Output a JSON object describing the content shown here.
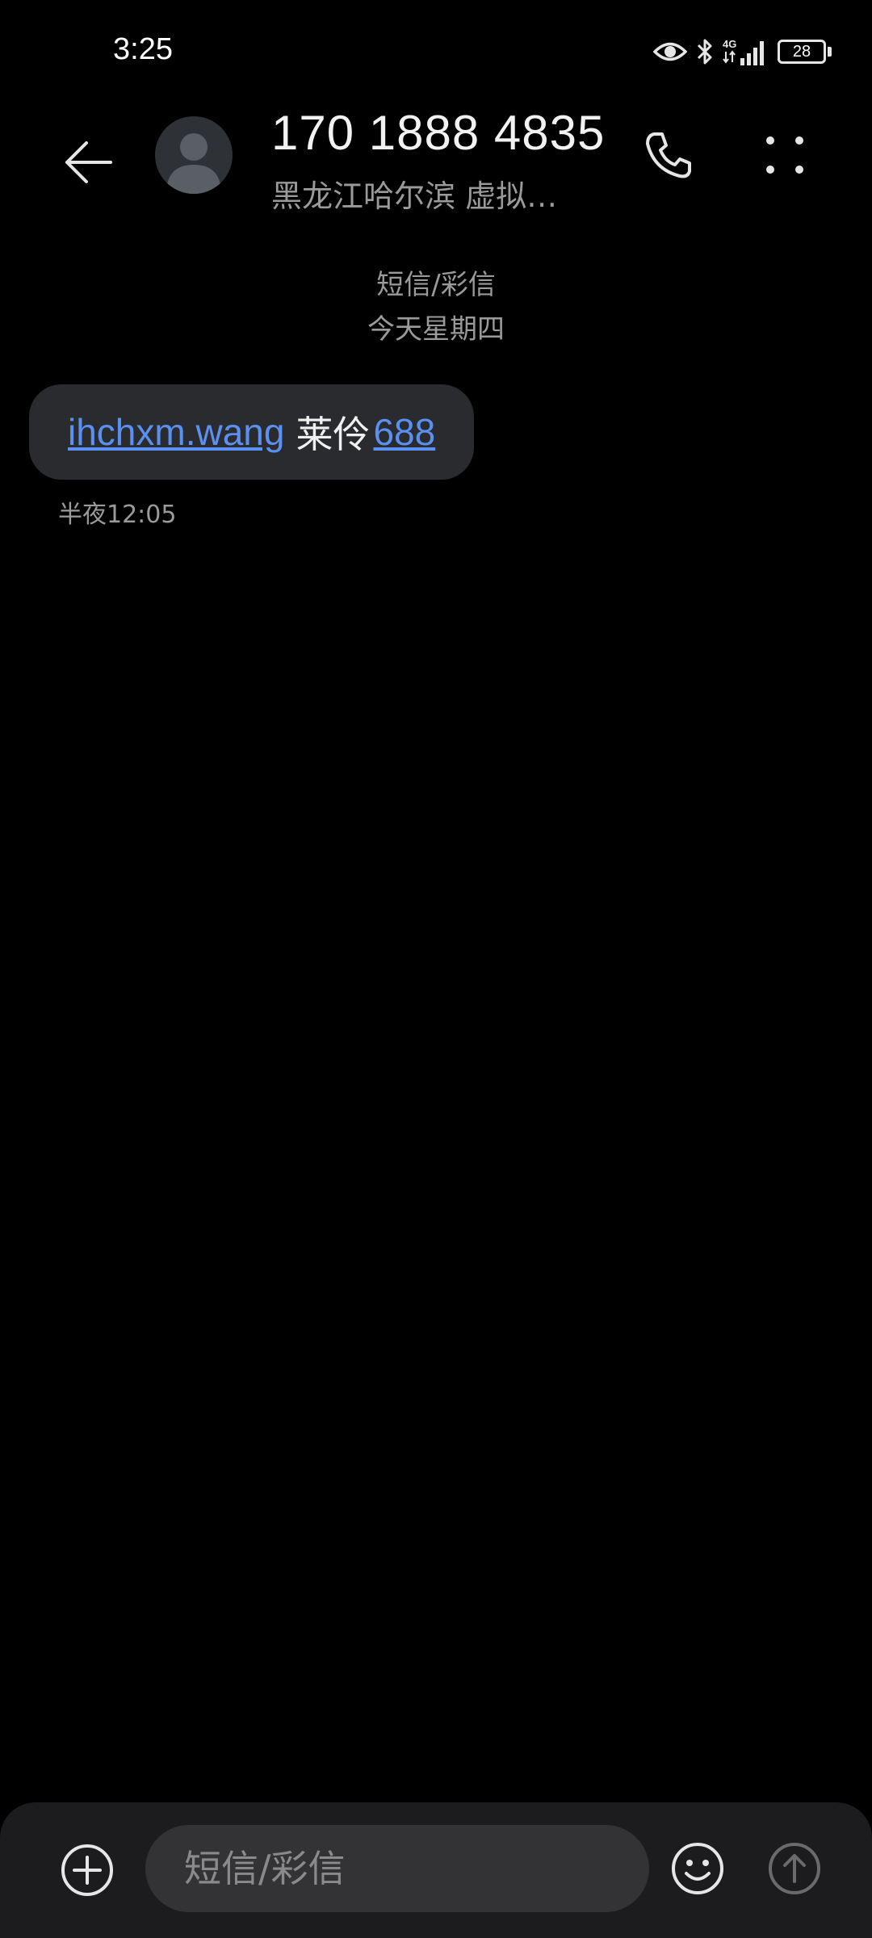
{
  "status_bar": {
    "time": "3:25",
    "network_label": "4G",
    "battery_level": "28",
    "icons": [
      "eye-comfort-icon",
      "bluetooth-icon",
      "signal-4g-icon",
      "battery-icon"
    ]
  },
  "header": {
    "contact_number": "170 1888 4835",
    "contact_location": "黑龙江哈尔滨 虚拟…",
    "icons": [
      "back-arrow-icon",
      "avatar-person-icon",
      "phone-icon",
      "more-options-icon"
    ]
  },
  "conversation": {
    "channel_label": "短信/彩信",
    "date_label": "今天星期四",
    "messages": [
      {
        "link_text": "ihchxm.wang",
        "text": "莱伶",
        "number_link": "688",
        "time": "半夜12:05"
      }
    ]
  },
  "compose": {
    "placeholder": "短信/彩信",
    "value": "",
    "icons": [
      "add-circle-icon",
      "emoji-icon",
      "send-arrow-icon"
    ]
  },
  "colors": {
    "background": "#000000",
    "bubble": "#2a2b2e",
    "link": "#5b8ff0",
    "secondary_text": "#9a9a9a",
    "compose_bar": "#1c1c1e"
  }
}
